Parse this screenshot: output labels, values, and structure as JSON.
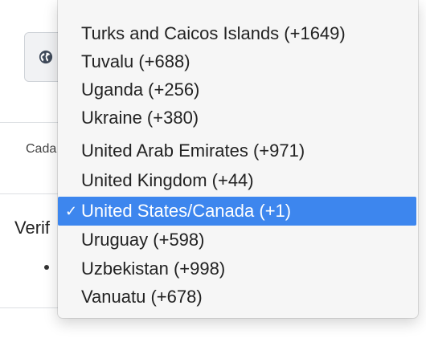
{
  "background": {
    "cada_text": "Cada",
    "verif_text": "Verif"
  },
  "dropdown": {
    "selected_index": 6,
    "options": [
      "Turks and Caicos Islands (+1649)",
      "Tuvalu (+688)",
      "Uganda (+256)",
      "Ukraine (+380)",
      "United Arab Emirates (+971)",
      "United Kingdom (+44)",
      "United States/Canada (+1)",
      "Uruguay (+598)",
      "Uzbekistan (+998)",
      "Vanuatu (+678)"
    ],
    "checkmark": "✓"
  },
  "colors": {
    "selection": "#3d86ee",
    "globe": "#3f4a5a"
  }
}
